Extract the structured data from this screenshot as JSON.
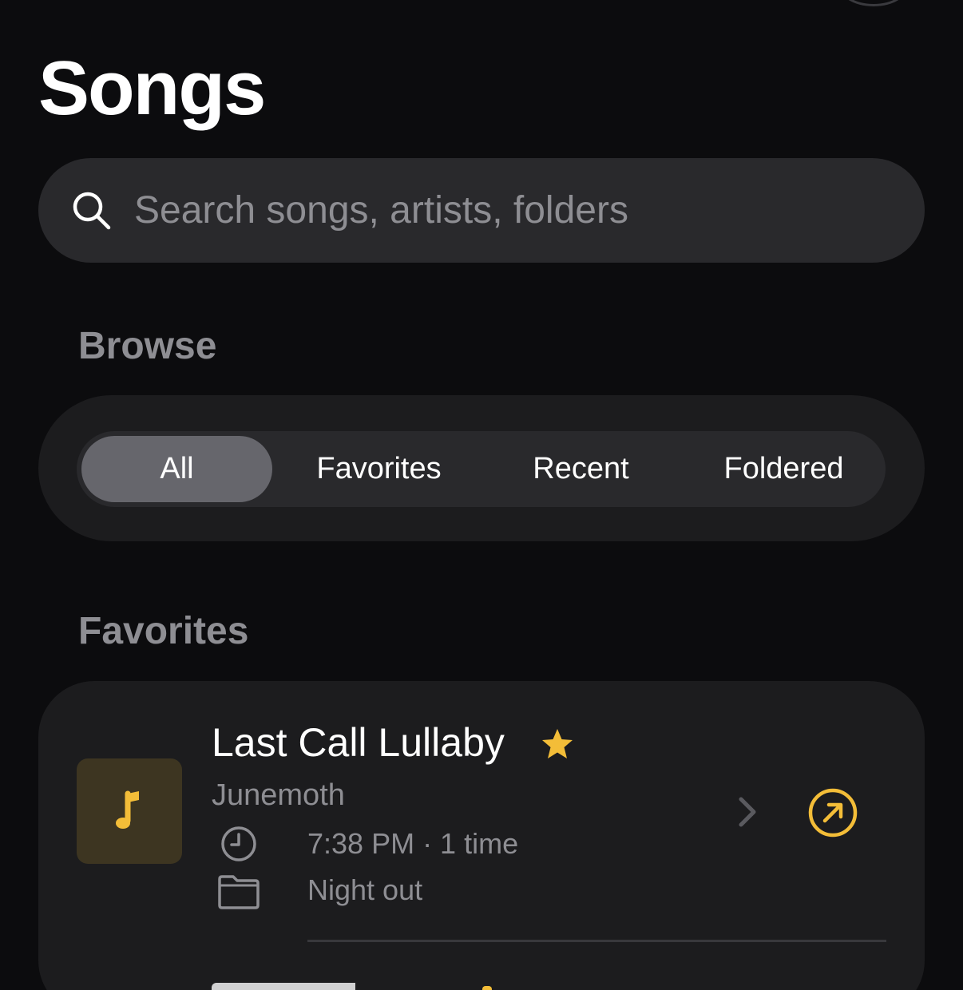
{
  "header": {
    "title": "Songs"
  },
  "search": {
    "placeholder": "Search songs, artists, folders",
    "icon": "search-icon"
  },
  "browse": {
    "label": "Browse",
    "segments": [
      {
        "label": "All",
        "selected": true
      },
      {
        "label": "Favorites",
        "selected": false
      },
      {
        "label": "Recent",
        "selected": false
      },
      {
        "label": "Foldered",
        "selected": false
      }
    ]
  },
  "favorites": {
    "label": "Favorites",
    "items": [
      {
        "title": "Last Call Lullaby",
        "artist": "Junemoth",
        "favorite": true,
        "played": "7:38 PM · 1 time",
        "folder": "Night out",
        "artwork_icon": "music-note-icon"
      }
    ]
  },
  "colors": {
    "background": "#0c0c0e",
    "card": "#1c1c1e",
    "field": "#29292c",
    "accent": "#f3bd38",
    "secondary_text": "#8e8e93"
  }
}
